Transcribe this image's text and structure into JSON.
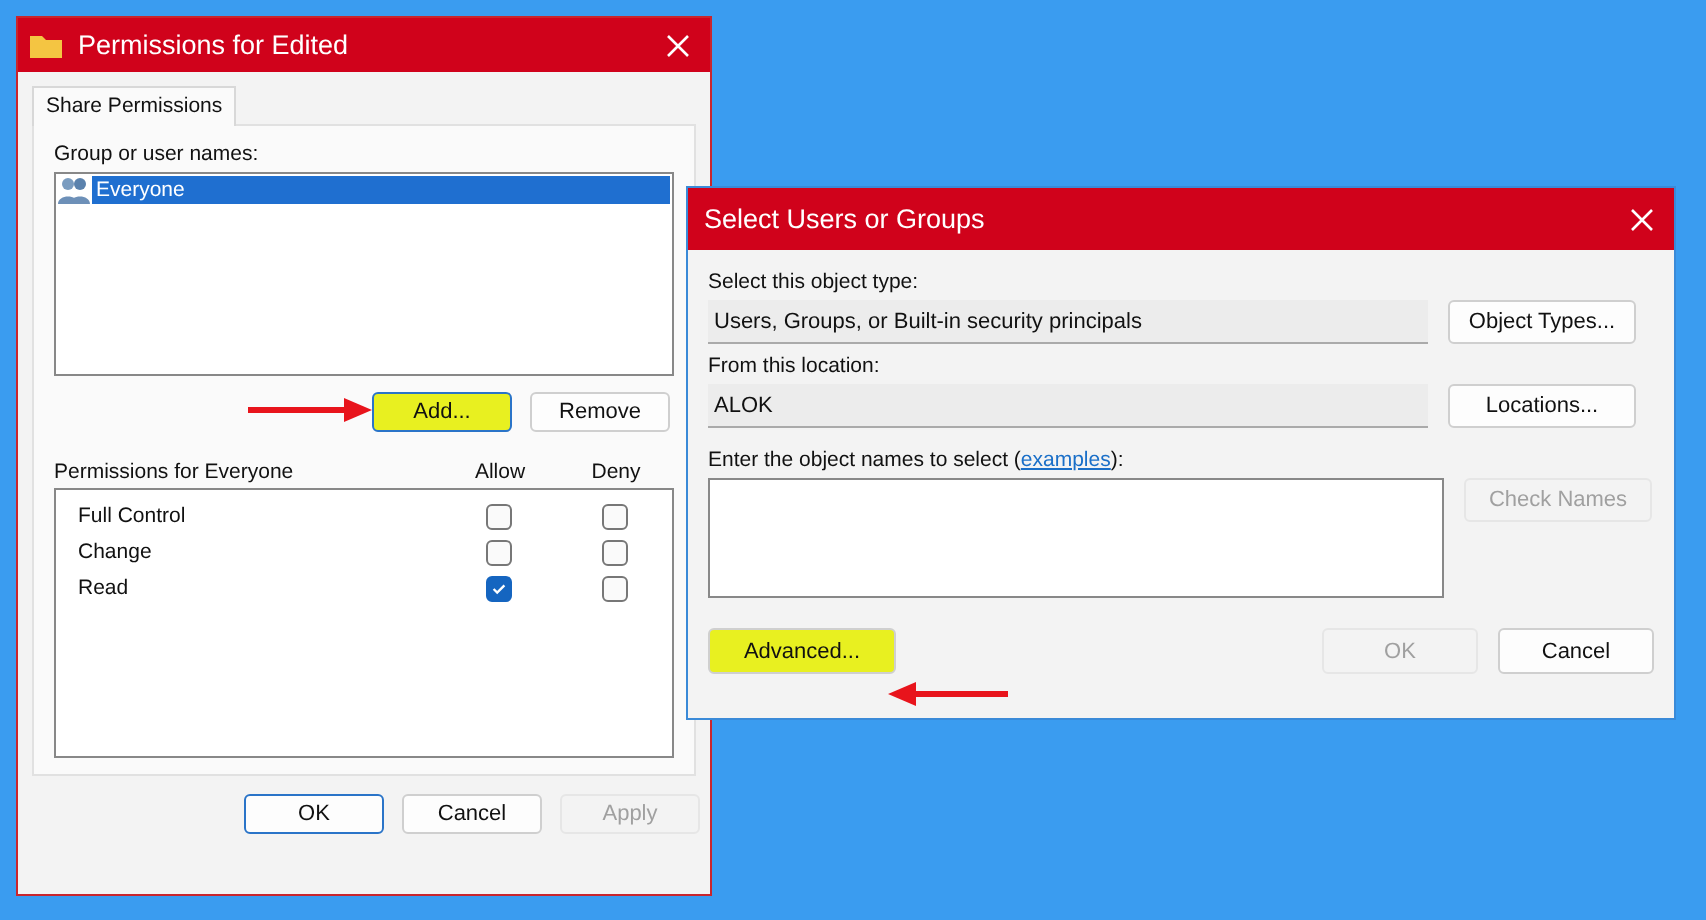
{
  "permissions_dialog": {
    "title": "Permissions for Edited",
    "tabs": [
      {
        "label": "Share Permissions",
        "selected": true
      }
    ],
    "group_label": "Group or user names:",
    "users": [
      {
        "name": "Everyone",
        "selected": true
      }
    ],
    "buttons": [
      {
        "label": "Add...",
        "highlighted": true,
        "disabled": false,
        "default": true
      },
      {
        "label": "Remove",
        "highlighted": false,
        "disabled": false,
        "default": false
      }
    ],
    "permissions_label": "Permissions for Everyone",
    "allow_label": "Allow",
    "deny_label": "Deny",
    "permissions": [
      {
        "name": "Full Control",
        "allow": false,
        "deny": false
      },
      {
        "name": "Change",
        "allow": false,
        "deny": false
      },
      {
        "name": "Read",
        "allow": true,
        "deny": false
      }
    ],
    "footer_buttons": [
      {
        "label": "OK",
        "highlighted": false,
        "disabled": false,
        "default": true
      },
      {
        "label": "Cancel",
        "highlighted": false,
        "disabled": false,
        "default": false
      },
      {
        "label": "Apply",
        "highlighted": false,
        "disabled": true,
        "default": false
      }
    ]
  },
  "select_dialog": {
    "title": "Select Users or Groups",
    "object_type_label": "Select this object type:",
    "object_type": "Users, Groups, or Built-in security principals",
    "object_types_button": "Object Types...",
    "location_label": "From this location:",
    "location": "ALOK",
    "locations_button": "Locations...",
    "names_label": "Enter the object names to select (",
    "names_link": "examples",
    "names_label_end": "):",
    "check_names_button": "Check Names",
    "footer_buttons": [
      {
        "label": "Advanced...",
        "highlighted": true,
        "disabled": false,
        "default": false
      },
      {
        "label": "OK",
        "highlighted": false,
        "disabled": true,
        "default": false
      },
      {
        "label": "Cancel",
        "highlighted": false,
        "disabled": false,
        "default": false
      }
    ]
  }
}
